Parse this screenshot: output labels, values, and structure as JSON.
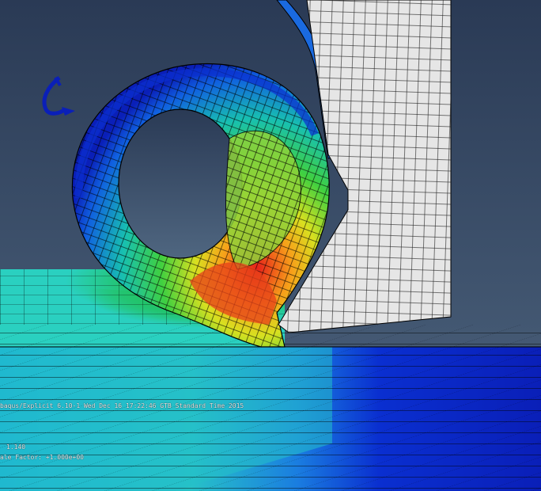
{
  "viewport": {
    "background_top": "#2a3a55",
    "background_bottom": "#4f6680",
    "status_text": "baqus/Explicit 6.10-1   Wed Dec 16 17:22:46 GTB Standard Time 2015",
    "step_text": "1.140",
    "scale_text": "ale Factor: +1.000e+00"
  },
  "colors": {
    "tool_fill": "#e6e6e6",
    "stress_low": "#0a1fb8",
    "stress_mid": "#22c36a",
    "stress_high": "#e7201a",
    "mesh_line": "#000000"
  },
  "icons": {
    "triad": "axis-triad-icon"
  }
}
